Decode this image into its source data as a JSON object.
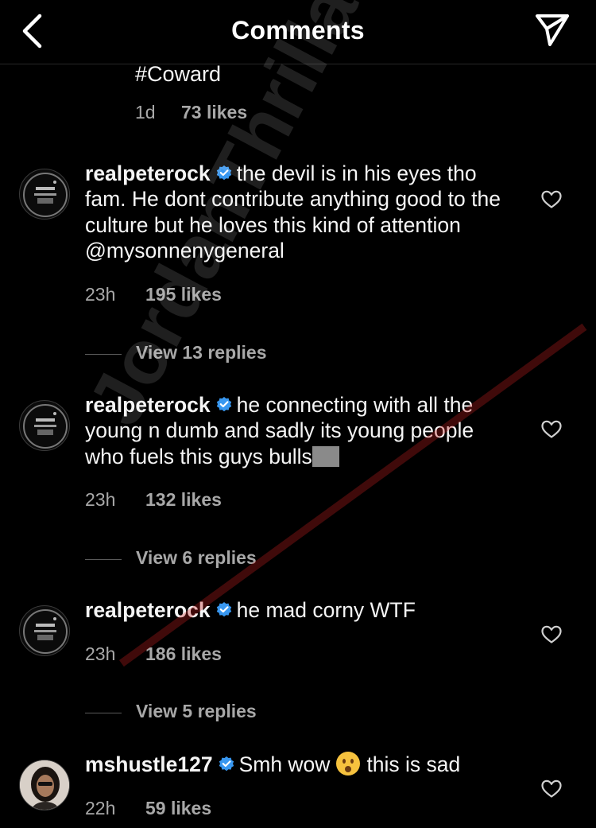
{
  "header": {
    "title": "Comments"
  },
  "previous_comment": {
    "text": "#Coward",
    "time": "1d",
    "likes": "73 likes"
  },
  "comments": [
    {
      "username": "realpeterock",
      "text": "the devil is in his eyes tho fam.  He dont contribute anything good to the culture but he loves this kind of attention @mysonnenygeneral",
      "time": "23h",
      "likes": "195 likes",
      "replies": "View 13 replies"
    },
    {
      "username": "realpeterock",
      "text": "he connecting with all the young n dumb and sadly its young people who fuels this guys bulls",
      "time": "23h",
      "likes": "132 likes",
      "replies": "View 6 replies"
    },
    {
      "username": "realpeterock",
      "text": "he mad corny WTF",
      "time": "23h",
      "likes": "186 likes",
      "replies": "View 5 replies"
    },
    {
      "username": "mshustle127",
      "text_before_emoji": "Smh wow",
      "text_after_emoji": "this is sad",
      "time": "22h",
      "likes": "59 likes"
    }
  ],
  "watermark": "JordanThrilla.com",
  "colors": {
    "background": "#000000",
    "text": "#f5f5f5",
    "muted": "#a8a8a8",
    "verified": "#3897f0"
  }
}
